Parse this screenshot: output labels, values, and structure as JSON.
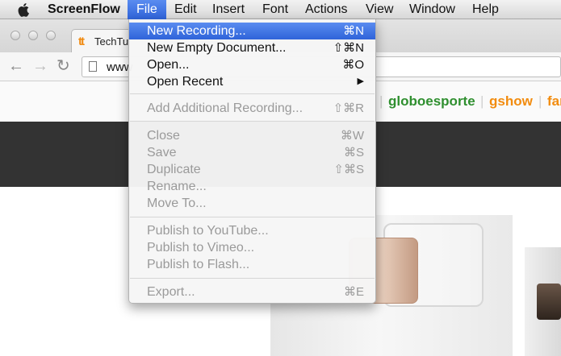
{
  "menubar": {
    "app_name": "ScreenFlow",
    "items": [
      "File",
      "Edit",
      "Insert",
      "Font",
      "Actions",
      "View",
      "Window",
      "Help"
    ]
  },
  "browser": {
    "tab_title": "TechTu",
    "favicon": "tt",
    "url": "www",
    "site_links": [
      {
        "label": "globoesporte",
        "color": "#2f8f2f"
      },
      {
        "label": "gshow",
        "color": "#f28c0f"
      },
      {
        "label": "far",
        "color": "#f28c0f"
      }
    ]
  },
  "file_menu": {
    "items": [
      {
        "label": "New Recording...",
        "shortcut": "⌘N",
        "state": "highlighted"
      },
      {
        "label": "New Empty Document...",
        "shortcut": "⇧⌘N",
        "state": "enabled"
      },
      {
        "label": "Open...",
        "shortcut": "⌘O",
        "state": "enabled"
      },
      {
        "label": "Open Recent",
        "shortcut": "▶",
        "state": "enabled"
      },
      {
        "label": "Add Additional Recording...",
        "shortcut": "⇧⌘R",
        "state": "disabled"
      },
      {
        "label": "Close",
        "shortcut": "⌘W",
        "state": "disabled"
      },
      {
        "label": "Save",
        "shortcut": "⌘S",
        "state": "disabled"
      },
      {
        "label": "Duplicate",
        "shortcut": "⇧⌘S",
        "state": "disabled"
      },
      {
        "label": "Rename...",
        "shortcut": "",
        "state": "disabled"
      },
      {
        "label": "Move To...",
        "shortcut": "",
        "state": "disabled"
      },
      {
        "label": "Publish to YouTube...",
        "shortcut": "",
        "state": "disabled"
      },
      {
        "label": "Publish to Vimeo...",
        "shortcut": "",
        "state": "disabled"
      },
      {
        "label": "Publish to Flash...",
        "shortcut": "",
        "state": "disabled"
      },
      {
        "label": "Export...",
        "shortcut": "⌘E",
        "state": "disabled"
      }
    ]
  },
  "colors": {
    "menu_highlight": "#3a6fe0",
    "disabled_text": "#9a9a9a",
    "dark_band": "#333333"
  }
}
